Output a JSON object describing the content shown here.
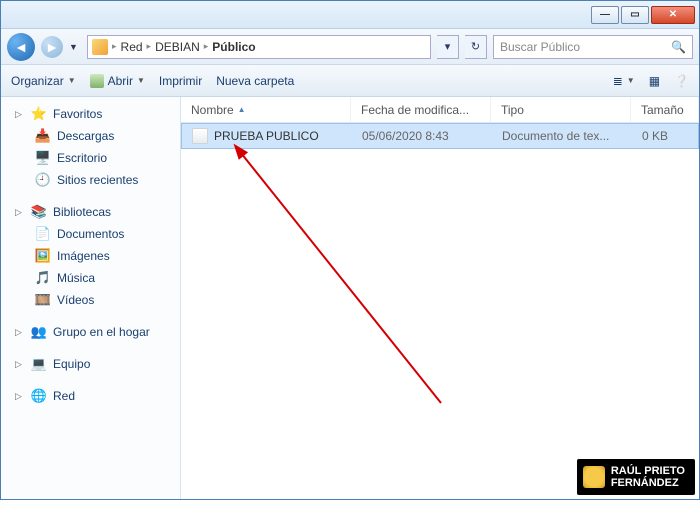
{
  "window_controls": {
    "min": "—",
    "max": "▭",
    "close": "✕"
  },
  "breadcrumb": {
    "root": "Red",
    "l1": "DEBIAN",
    "l2": "Público"
  },
  "search": {
    "placeholder": "Buscar Público"
  },
  "toolbar": {
    "organize": "Organizar",
    "open": "Abrir",
    "print": "Imprimir",
    "newfolder": "Nueva carpeta"
  },
  "sidebar": {
    "favorites": {
      "label": "Favoritos",
      "items": [
        "Descargas",
        "Escritorio",
        "Sitios recientes"
      ]
    },
    "libraries": {
      "label": "Bibliotecas",
      "items": [
        "Documentos",
        "Imágenes",
        "Música",
        "Vídeos"
      ]
    },
    "homegroup": {
      "label": "Grupo en el hogar"
    },
    "computer": {
      "label": "Equipo"
    },
    "network": {
      "label": "Red"
    }
  },
  "columns": {
    "name": "Nombre",
    "modified": "Fecha de modifica...",
    "type": "Tipo",
    "size": "Tamaño"
  },
  "files": [
    {
      "name": "PRUEBA PUBLICO",
      "modified": "05/06/2020 8:43",
      "type": "Documento de tex...",
      "size": "0 KB"
    }
  ],
  "watermark": {
    "line1": "RAÚL PRIETO",
    "line2": "FERNÁNDEZ"
  }
}
